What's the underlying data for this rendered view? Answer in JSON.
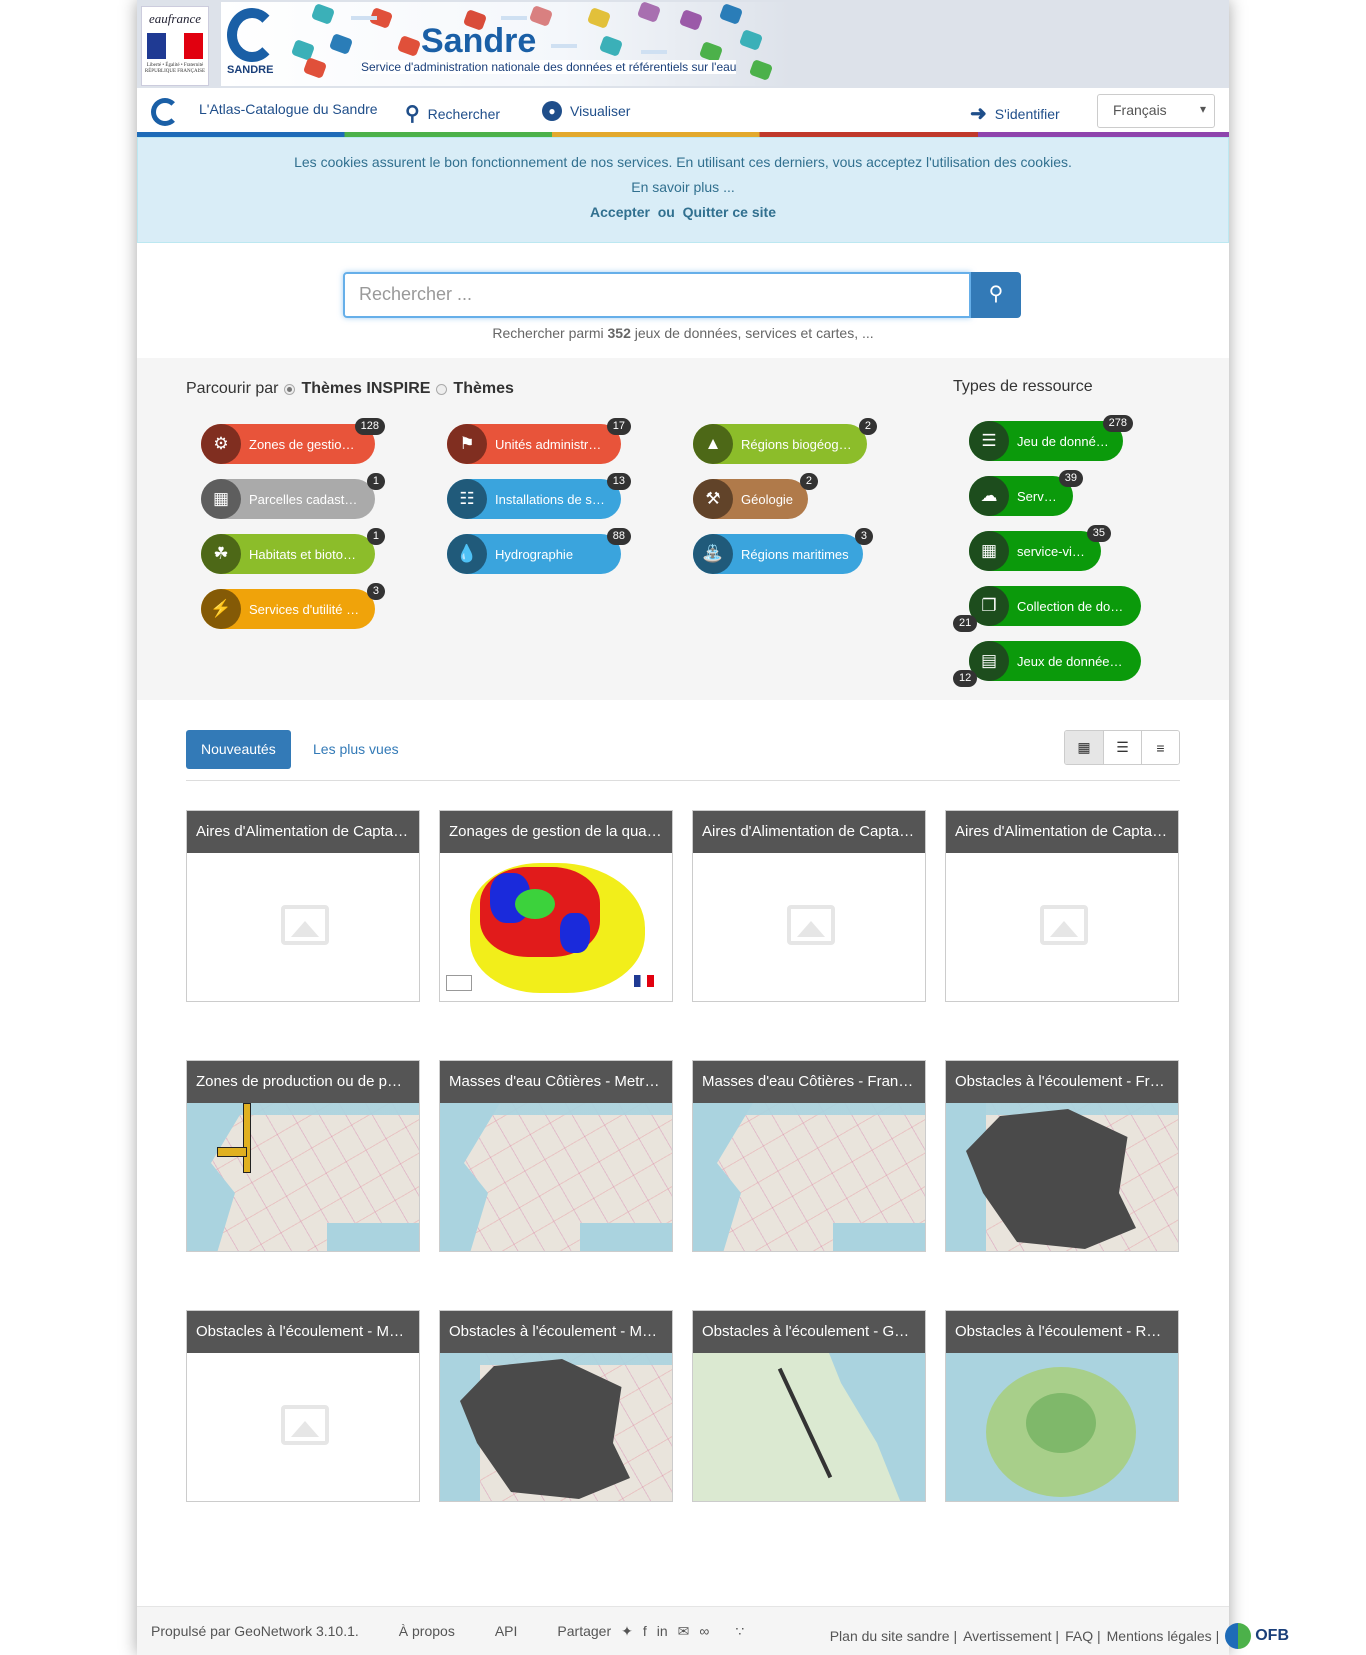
{
  "banner": {
    "eaufrance": "eaufrance",
    "eaufrance_motto": "Liberté • Égalité • Fraternité",
    "eaufrance_republic": "RÉPUBLIQUE FRANÇAISE",
    "sandre_label": "SANDRE",
    "sandre_name": "Sandre",
    "sandre_tagline": "Service d'administration nationale des données et référentiels sur l'eau"
  },
  "nav": {
    "home": "L'Atlas-Catalogue du Sandre",
    "search": "Rechercher",
    "map": "Visualiser",
    "signin": "S'identifier",
    "language": "Français"
  },
  "cookie": {
    "message": "Les cookies assurent le bon fonctionnement de nos services. En utilisant ces derniers, vous acceptez l'utilisation des cookies.",
    "more": "En savoir plus ...",
    "accept": "Accepter",
    "or": "ou",
    "quit": "Quitter ce site"
  },
  "search": {
    "placeholder": "Rechercher ...",
    "count_prefix": "Rechercher parmi",
    "count": "352",
    "count_suffix": "jeux de données, services et cartes, ..."
  },
  "browse": {
    "label": "Parcourir par",
    "opt1": "Thèmes INSPIRE",
    "opt2": "Thèmes",
    "types_title": "Types de ressource",
    "topics": [
      {
        "label": "Zones de gestion, de restriction ou de réglementation",
        "count": "128",
        "color": "#e8543a",
        "icon": "zones-icon"
      },
      {
        "label": "Unités administratives",
        "count": "17",
        "color": "#e8543a",
        "icon": "admin-units-icon"
      },
      {
        "label": "Régions biogéographiques",
        "count": "2",
        "color": "#8cbd2a",
        "icon": "bioregions-icon"
      },
      {
        "label": "Parcelles cadastrales",
        "count": "1",
        "color": "#aaaaaa",
        "icon": "cadastral-icon"
      },
      {
        "label": "Installations de suivi environnemental",
        "count": "13",
        "color": "#3aa4dd",
        "icon": "monitoring-icon"
      },
      {
        "label": "Géologie",
        "count": "2",
        "color": "#b07a4a",
        "icon": "geology-icon"
      },
      {
        "label": "Habitats et biotopes",
        "count": "1",
        "color": "#8cbd2a",
        "icon": "habitats-icon"
      },
      {
        "label": "Hydrographie",
        "count": "88",
        "color": "#3aa4dd",
        "icon": "water-drop-icon"
      },
      {
        "label": "Régions maritimes",
        "count": "3",
        "color": "#3aa4dd",
        "icon": "sea-regions-icon"
      },
      {
        "label": "Services d'utilité publique et services publics",
        "count": "3",
        "color": "#f0a30a",
        "icon": "utility-icon"
      }
    ],
    "types": [
      {
        "label": "Jeu de données",
        "count": "278",
        "icon": "database-icon"
      },
      {
        "label": "Service",
        "count": "39",
        "icon": "cloud-icon"
      },
      {
        "label": "service-view",
        "count": "35",
        "icon": "table-icon"
      },
      {
        "label": "Collection de données",
        "count": "21",
        "icon": "copy-icon"
      },
      {
        "label": "Jeux de données non géographiques",
        "count": "12",
        "icon": "bar-chart-icon"
      }
    ]
  },
  "tabs": {
    "new": "Nouveautés",
    "popular": "Les plus vues"
  },
  "cards": [
    {
      "title": "Aires d'Alimentation de Captages - Métropole"
    },
    {
      "title": "Zonages de gestion de la qualité de l'eau"
    },
    {
      "title": "Aires d'Alimentation de Captages - France entière"
    },
    {
      "title": "Aires d'Alimentation de Captages - Outre-mer"
    },
    {
      "title": "Zones de production ou de parcage conchylicole"
    },
    {
      "title": "Masses d'eau Côtières - Metropole"
    },
    {
      "title": "Masses d'eau Côtières - France entière"
    },
    {
      "title": "Obstacles à l'écoulement - France entière"
    },
    {
      "title": "Obstacles à l'écoulement - Martinique"
    },
    {
      "title": "Obstacles à l'écoulement - Métropole"
    },
    {
      "title": "Obstacles à l'écoulement - Guyane"
    },
    {
      "title": "Obstacles à l'écoulement - Réunion"
    }
  ],
  "footer": {
    "powered": "Propulsé par GeoNetwork 3.10.1.",
    "about": "À propos",
    "api": "API",
    "share": "Partager",
    "sitemap": "Plan du site sandre |",
    "warning": "Avertissement |",
    "faq": "FAQ |",
    "legal": "Mentions légales |",
    "ofb": "OFB"
  }
}
